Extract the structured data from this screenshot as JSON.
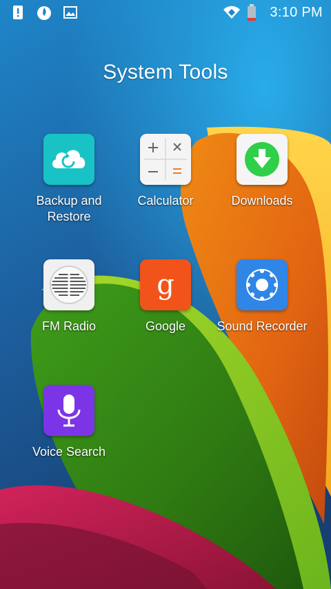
{
  "status_bar": {
    "left_icons": [
      "alert-icon",
      "flame-icon",
      "image-icon"
    ],
    "right_icons": [
      "wifi-icon",
      "battery-icon"
    ],
    "time": "3:10 PM"
  },
  "folder": {
    "title": "System Tools"
  },
  "apps": [
    {
      "label": "Backup and\nRestore",
      "icon": "cloud-restore-icon",
      "color": "#19c3c5"
    },
    {
      "label": "Calculator",
      "icon": "calculator-icon",
      "color": "#f2f2f2"
    },
    {
      "label": "Downloads",
      "icon": "download-icon",
      "color": "#f5f5f5"
    },
    {
      "label": "FM Radio",
      "icon": "radio-icon",
      "color": "#f0f0f0"
    },
    {
      "label": "Google",
      "icon": "google-icon",
      "color": "#f2531a"
    },
    {
      "label": "Sound Recorder",
      "icon": "recorder-icon",
      "color": "#2f86e6"
    },
    {
      "label": "Voice Search",
      "icon": "microphone-icon",
      "color": "#7c35e6"
    }
  ]
}
